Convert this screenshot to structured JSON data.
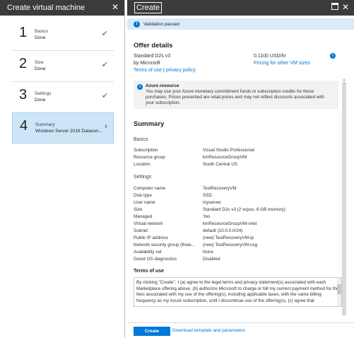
{
  "left": {
    "title": "Create virtual machine",
    "steps": [
      {
        "num": "1",
        "label": "Basics",
        "value": "Done"
      },
      {
        "num": "2",
        "label": "Size",
        "value": "Done"
      },
      {
        "num": "3",
        "label": "Settings",
        "value": "Done"
      },
      {
        "num": "4",
        "label": "Summary",
        "value": "Windows Server 2016 Datacen..."
      }
    ]
  },
  "right": {
    "title": "Create",
    "validation": "Validation passed",
    "offer": {
      "heading": "Offer details",
      "name": "Standard D2s v3",
      "by": "by Microsoft",
      "terms_link": "Terms of use",
      "separator": "|",
      "privacy_link": "privacy policy",
      "price": "0.1100 USD/hr",
      "pricing_link": "Pricing for other VM sizes"
    },
    "azure": {
      "title": "Azure resource",
      "body": "You may use your Azure monetary commitment funds or subscription credits for these purchases. Prices presented are retail prices and may not reflect discounts associated with your subscription."
    },
    "summary": {
      "heading": "Summary",
      "basics_heading": "Basics",
      "basics": [
        {
          "label": "Subscription",
          "value": "Visual Studio Professional"
        },
        {
          "label": "Resource group",
          "value": "kmResourceGroupVM"
        },
        {
          "label": "Location",
          "value": "South Central US"
        }
      ],
      "settings_heading": "Settings",
      "settings": [
        {
          "label": "Computer name",
          "value": "TestRecoveryVM"
        },
        {
          "label": "Disk type",
          "value": "SSD"
        },
        {
          "label": "User name",
          "value": "myserver"
        },
        {
          "label": "Size",
          "value": "Standard D2s v3 (2 vcpus, 8 GB memory)"
        },
        {
          "label": "Managed",
          "value": "Yes"
        },
        {
          "label": "Virtual network",
          "value": "kmResourceGroupVM-vnet"
        },
        {
          "label": "Subnet",
          "value": "default (10.0.0.0/24)"
        },
        {
          "label": "Public IP address",
          "value": "(new) TestRecoveryVM-ip"
        },
        {
          "label": "Network security group (firew...",
          "value": "(new) TestRecoveryVM-nsg"
        },
        {
          "label": "Availability set",
          "value": "None"
        },
        {
          "label": "Guest OS diagnostics",
          "value": "Disabled"
        }
      ]
    },
    "terms": {
      "heading": "Terms of use",
      "text": "By clicking \"Create\", I (a) agree to the legal terms and privacy statement(s) associated with each Marketplace offering above, (b) authorize Microsoft to charge or bill my current payment method for the fees associated with my use of the offering(s), including applicable taxes, with the same billing frequency as my Azure subscription, until I discontinue use of the offering(s), (c) agree that"
    },
    "footer": {
      "create_label": "Create",
      "download_label": "Download template and parameters"
    }
  },
  "colors": {
    "accent": "#0078d7",
    "header": "#3b3b3b",
    "selected": "#cde6f7",
    "check": "#6aa84f"
  }
}
